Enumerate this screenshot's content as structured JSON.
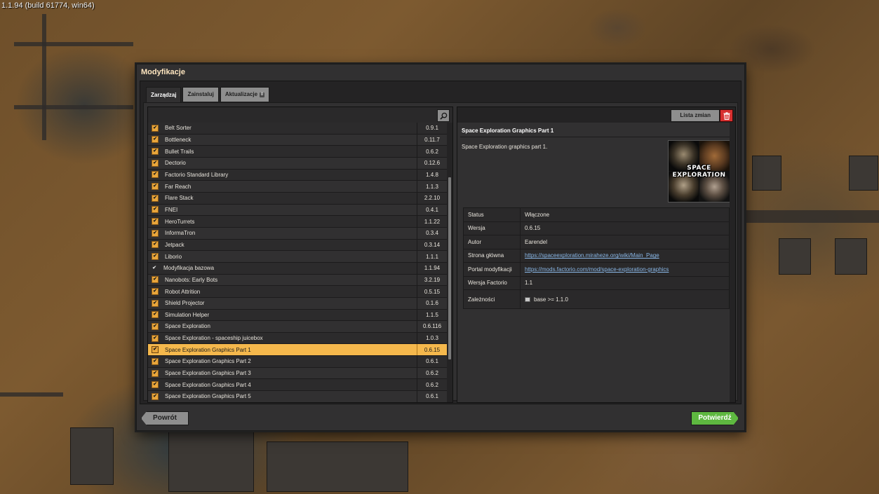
{
  "version_text": "1.1.94 (build 61774, win64)",
  "window": {
    "title": "Modyfikacje",
    "tabs": [
      {
        "label": "Zarządzaj",
        "active": true
      },
      {
        "label": "Zainstaluj",
        "active": false
      },
      {
        "label": "Aktualizacje",
        "active": false,
        "badge": "0"
      }
    ],
    "back_label": "Powrót",
    "confirm_label": "Potwierdź"
  },
  "mods": [
    {
      "name": "Belt Sorter",
      "version": "0.9.1"
    },
    {
      "name": "Bottleneck",
      "version": "0.11.7"
    },
    {
      "name": "Bullet Trails",
      "version": "0.6.2"
    },
    {
      "name": "Dectorio",
      "version": "0.12.6"
    },
    {
      "name": "Factorio Standard Library",
      "version": "1.4.8"
    },
    {
      "name": "Far Reach",
      "version": "1.1.3"
    },
    {
      "name": "Flare Stack",
      "version": "2.2.10"
    },
    {
      "name": "FNEI",
      "version": "0.4.1"
    },
    {
      "name": "HeroTurrets",
      "version": "1.1.22"
    },
    {
      "name": "InformaTron",
      "version": "0.3.4"
    },
    {
      "name": "Jetpack",
      "version": "0.3.14"
    },
    {
      "name": "Liborio",
      "version": "1.1.1"
    },
    {
      "name": "Modyfikacja bazowa",
      "version": "1.1.94",
      "locked": true
    },
    {
      "name": "Nanobots: Early Bots",
      "version": "3.2.19"
    },
    {
      "name": "Robot Attrition",
      "version": "0.5.15"
    },
    {
      "name": "Shield Projector",
      "version": "0.1.6"
    },
    {
      "name": "Simulation Helper",
      "version": "1.1.5"
    },
    {
      "name": "Space Exploration",
      "version": "0.6.116"
    },
    {
      "name": "Space Exploration - spaceship juicebox",
      "version": "1.0.3"
    },
    {
      "name": "Space Exploration Graphics Part 1",
      "version": "0.6.15",
      "selected": true
    },
    {
      "name": "Space Exploration Graphics Part 2",
      "version": "0.6.1"
    },
    {
      "name": "Space Exploration Graphics Part 3",
      "version": "0.6.2"
    },
    {
      "name": "Space Exploration Graphics Part 4",
      "version": "0.6.2"
    },
    {
      "name": "Space Exploration Graphics Part 5",
      "version": "0.6.1"
    }
  ],
  "detail": {
    "changelog_label": "Lista zmian",
    "title": "Space Exploration Graphics Part 1",
    "description": "Space Exploration graphics part 1.",
    "thumbnail_text_1": "SPACE",
    "thumbnail_text_2": "EXPLORATION",
    "info": [
      {
        "key": "Status",
        "value": "Włączone"
      },
      {
        "key": "Wersja",
        "value": "0.6.15"
      },
      {
        "key": "Autor",
        "value": "Earendel"
      },
      {
        "key": "Strona główna",
        "value": "https://spaceexploration.miraheze.org/wiki/Main_Page",
        "link": true
      },
      {
        "key": "Portal modyfikacji",
        "value": "https://mods.factorio.com/mod/space-exploration-graphics",
        "link": true
      },
      {
        "key": "Wersja Factorio",
        "value": "1.1"
      },
      {
        "key": "Zależności",
        "value": "base >= 1.1.0",
        "dependency": true
      }
    ]
  },
  "icons": {
    "search": "search-icon",
    "delete": "trash-icon",
    "checkbox": "checkmark-icon",
    "dependency": "dependency-icon"
  },
  "colors": {
    "selected_row": "#f5b84c",
    "checkbox": "#e9a63b",
    "confirm": "#5eb840",
    "delete": "#d83030",
    "link": "#8ab8e8"
  }
}
